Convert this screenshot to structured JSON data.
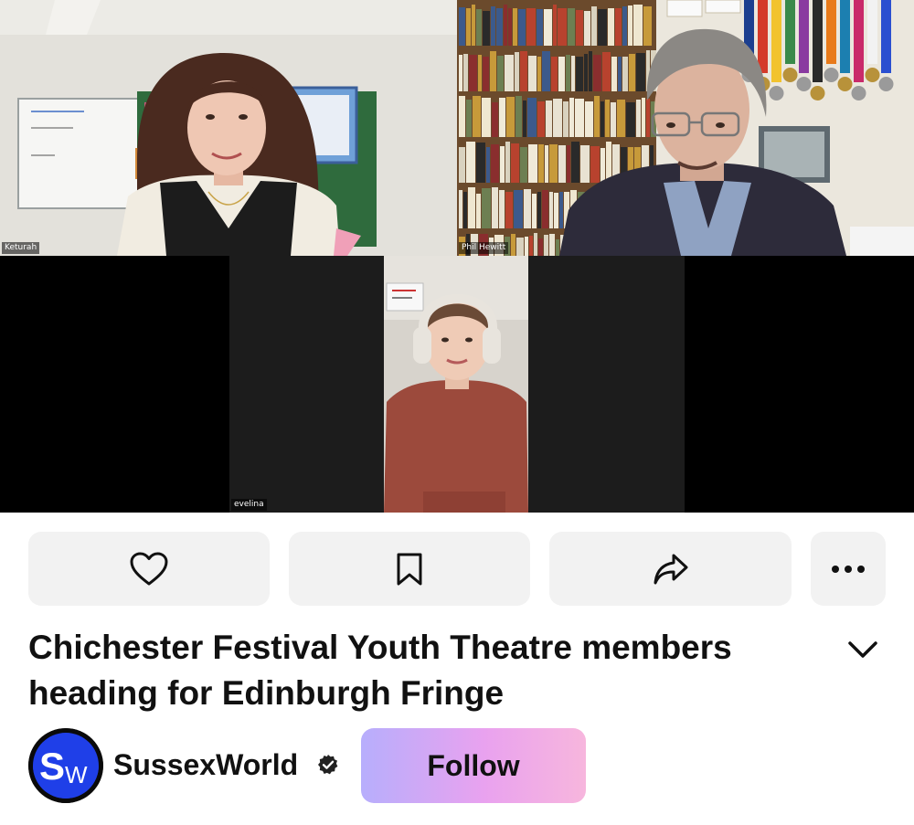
{
  "call": {
    "participants": [
      {
        "name": "Keturah"
      },
      {
        "name": "Phil Hewitt"
      },
      {
        "name": "evelina"
      }
    ]
  },
  "actions": {
    "like_icon": "heart-icon",
    "save_icon": "bookmark-icon",
    "share_icon": "share-arrow-icon",
    "more_icon": "more-dots-icon"
  },
  "article": {
    "title": "Chichester Festival Youth Theatre members heading for Edinburgh Fringe",
    "expand_icon": "chevron-down-icon"
  },
  "publisher": {
    "logo_text_s": "S",
    "logo_text_w": "W",
    "name": "SussexWorld",
    "verified_icon": "verified-badge-icon",
    "follow_label": "Follow"
  },
  "colors": {
    "follow_gradient_start": "#b7aefc",
    "follow_gradient_end": "#f7b6dd",
    "logo_blue": "#1f3fe8",
    "button_bg": "#f2f2f2"
  }
}
